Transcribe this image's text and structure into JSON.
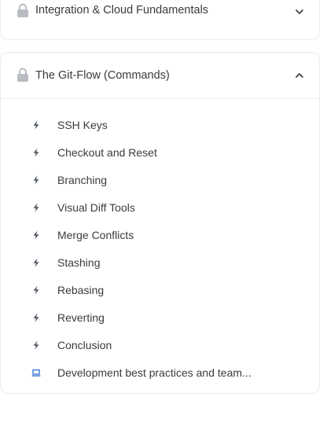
{
  "colors": {
    "lock": "#b9bcc2",
    "bolt": "#4d5560",
    "video": "#2f6fd6",
    "text": "#3b3b3b",
    "border": "#e9ebee"
  },
  "sections": [
    {
      "title": "Integration & Cloud Fundamentals",
      "icon": "lock-icon",
      "chevron": "chevron-down-icon"
    },
    {
      "title": "The Git-Flow (Commands)",
      "icon": "lock-icon",
      "chevron": "chevron-up-icon",
      "lessons": [
        {
          "title": "SSH Keys",
          "icon": "bolt-icon"
        },
        {
          "title": "Checkout and Reset",
          "icon": "bolt-icon"
        },
        {
          "title": "Branching",
          "icon": "bolt-icon"
        },
        {
          "title": "Visual Diff Tools",
          "icon": "bolt-icon"
        },
        {
          "title": "Merge Conflicts",
          "icon": "bolt-icon"
        },
        {
          "title": "Stashing",
          "icon": "bolt-icon"
        },
        {
          "title": "Rebasing",
          "icon": "bolt-icon"
        },
        {
          "title": "Reverting",
          "icon": "bolt-icon"
        },
        {
          "title": "Conclusion",
          "icon": "bolt-icon"
        },
        {
          "title": "Development best practices and team...",
          "icon": "video-icon"
        }
      ]
    }
  ]
}
